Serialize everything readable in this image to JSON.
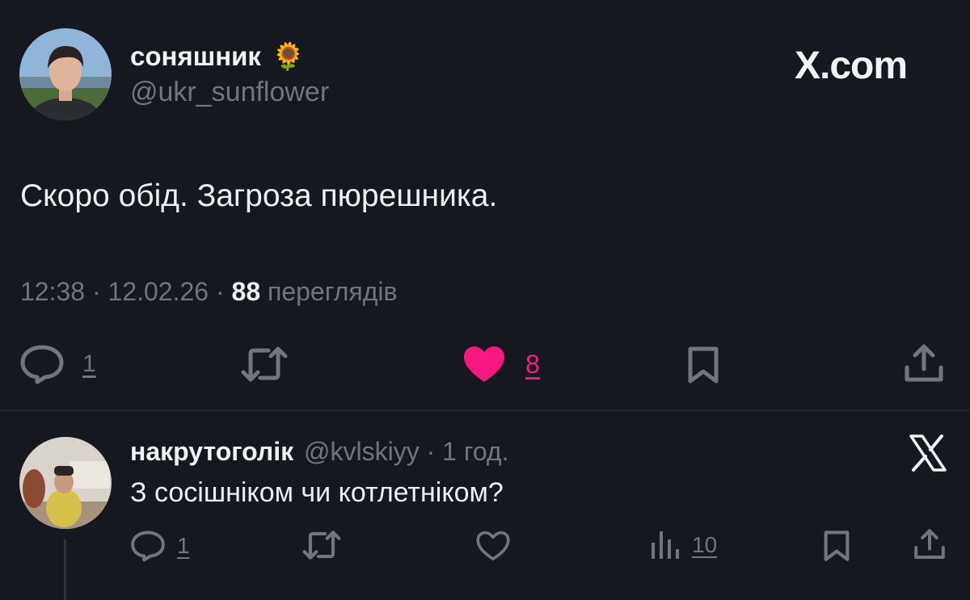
{
  "brand": {
    "logo_text": "X.com"
  },
  "tweet": {
    "display_name": "соняшник",
    "emoji": "🌻",
    "handle": "@ukr_sunflower",
    "text": "Скоро обід. Загроза пюрешника.",
    "time": "12:38",
    "sep": "·",
    "date": "12.02.26",
    "views_count": "88",
    "views_label": "переглядів",
    "reply_count": "1",
    "like_count": "8",
    "liked": true,
    "like_color": "#f91880"
  },
  "reply": {
    "display_name": "накрутоголік",
    "handle": "@kvlskiyy",
    "sep": "·",
    "time": "1 год.",
    "text": "З сосішніком чи котлетніком?",
    "reply_count": "1",
    "views_count": "10"
  },
  "colors": {
    "background": "#15181e",
    "muted": "#71767b",
    "text": "#e7e9ea"
  }
}
